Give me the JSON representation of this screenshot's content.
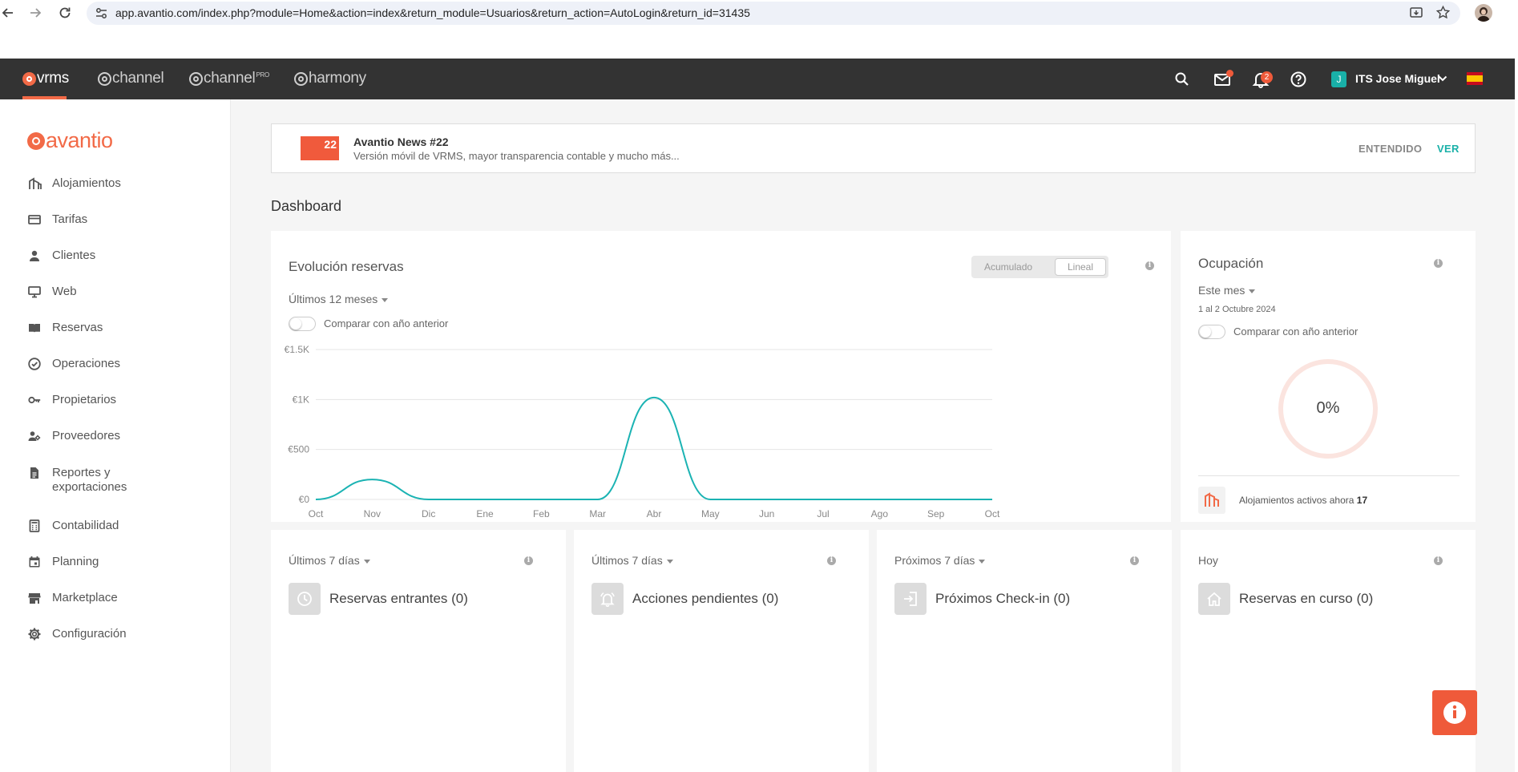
{
  "browser": {
    "url": "app.avantio.com/index.php?module=Home&action=index&return_module=Usuarios&return_action=AutoLogin&return_id=31435"
  },
  "topbar": {
    "products": [
      {
        "name": "vrms"
      },
      {
        "name": "channel"
      },
      {
        "name": "channel",
        "sup": "PRO"
      },
      {
        "name": "harmony"
      }
    ],
    "mail_badge": "",
    "notifications_count": "2",
    "user_initial": "J",
    "user_name": "ITS Jose Miguel",
    "accent_color": "#f26a47"
  },
  "sidebar": {
    "logo": "avantio",
    "items": [
      {
        "label": "Alojamientos",
        "icon": "building-icon"
      },
      {
        "label": "Tarifas",
        "icon": "card-icon"
      },
      {
        "label": "Clientes",
        "icon": "person-icon"
      },
      {
        "label": "Web",
        "icon": "monitor-icon"
      },
      {
        "label": "Reservas",
        "icon": "book-icon"
      },
      {
        "label": "Operaciones",
        "icon": "check-circle-icon"
      },
      {
        "label": "Propietarios",
        "icon": "key-icon"
      },
      {
        "label": "Proveedores",
        "icon": "people-icon"
      },
      {
        "label": "Reportes y exportaciones",
        "icon": "document-icon"
      },
      {
        "label": "Contabilidad",
        "icon": "calculator-icon"
      },
      {
        "label": "Planning",
        "icon": "calendar-icon"
      },
      {
        "label": "Marketplace",
        "icon": "store-icon"
      },
      {
        "label": "Configuración",
        "icon": "gear-icon"
      }
    ]
  },
  "news": {
    "badge": "22",
    "title": "Avantio News #22",
    "text": "Versión móvil de VRMS, mayor transparencia contable y mucho más...",
    "dismiss_label": "ENTENDIDO",
    "view_label": "VER"
  },
  "page_title": "Dashboard",
  "evolution": {
    "title": "Evolución reservas",
    "mode_options": [
      "Acumulado",
      "Lineal"
    ],
    "selected_mode": "Lineal",
    "period": "Últimos 12 meses",
    "compare_label": "Comparar con año anterior"
  },
  "chart_data": {
    "type": "line",
    "title": "Evolución reservas",
    "categories": [
      "Oct",
      "Nov",
      "Dic",
      "Ene",
      "Feb",
      "Mar",
      "Abr",
      "May",
      "Jun",
      "Jul",
      "Ago",
      "Sep",
      "Oct"
    ],
    "values": [
      0,
      200,
      0,
      0,
      0,
      0,
      1020,
      0,
      0,
      0,
      0,
      0,
      0
    ],
    "y_ticks": [
      "€0",
      "€500",
      "€1K",
      "€1.5K"
    ],
    "y_tick_values": [
      0,
      500,
      1000,
      1500
    ],
    "ylim": [
      0,
      1500
    ],
    "grid": true,
    "line_color": "#1bb3b3"
  },
  "occupancy": {
    "title": "Ocupación",
    "period": "Este mes",
    "date_range": "1 al 2 Octubre 2024",
    "compare_label": "Comparar con año anterior",
    "percent_label": "0%",
    "percent_value": 0,
    "active_label": "Alojamientos activos ahora",
    "active_count": "17"
  },
  "tiles": [
    {
      "period": "Últimos 7 días",
      "has_caret": true,
      "title": "Reservas entrantes (0)",
      "icon": "clock-icon"
    },
    {
      "period": "Últimos 7 días",
      "has_caret": true,
      "title": "Acciones pendientes (0)",
      "icon": "bell-icon"
    },
    {
      "period": "Próximos 7 días",
      "has_caret": true,
      "title": "Próximos Check-in (0)",
      "icon": "login-icon"
    },
    {
      "period": "Hoy",
      "has_caret": false,
      "title": "Reservas en curso (0)",
      "icon": "home-icon"
    }
  ]
}
